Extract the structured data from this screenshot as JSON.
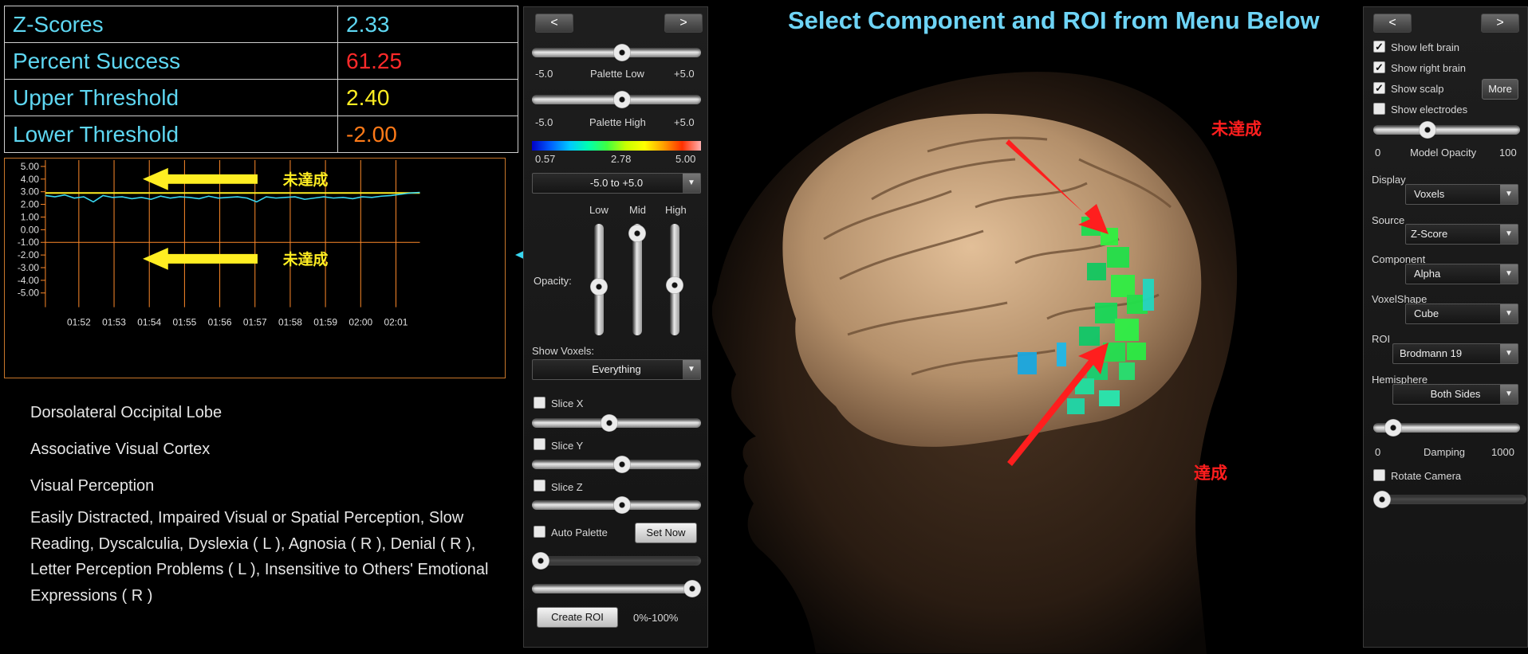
{
  "header": {
    "title": "Select Component and ROI from Menu Below"
  },
  "stats": [
    {
      "label": "Z-Scores",
      "value": "2.33",
      "color": "#5ed7f2"
    },
    {
      "label": "Percent Success",
      "value": "61.25",
      "color": "#ff2a2a"
    },
    {
      "label": "Upper Threshold",
      "value": "2.40",
      "color": "#ffee22"
    },
    {
      "label": "Lower Threshold",
      "value": "-2.00",
      "color": "#ff7a18"
    }
  ],
  "chart_data": {
    "type": "line",
    "x": [
      "01:52",
      "01:53",
      "01:54",
      "01:55",
      "01:56",
      "01:57",
      "01:58",
      "01:59",
      "02:00",
      "02:01"
    ],
    "ylim": [
      -5,
      5
    ],
    "yticks": [
      "5.00",
      "4.00",
      "3.00",
      "2.00",
      "1.00",
      "0.00",
      "-1.00",
      "-2.00",
      "-3.00",
      "-4.00",
      "-5.00"
    ],
    "upper_threshold": 2.9,
    "lower_threshold": -1.0,
    "series": [
      {
        "values": [
          2.7,
          2.6,
          2.75,
          2.5,
          2.6,
          2.2,
          2.7,
          2.55,
          2.6,
          2.45,
          2.55,
          2.4,
          2.65,
          2.5,
          2.6,
          2.55,
          2.45,
          2.65,
          2.5,
          2.55,
          2.6,
          2.5,
          2.2,
          2.6,
          2.5,
          2.55,
          2.6,
          2.4,
          2.5,
          2.6,
          2.5,
          2.55,
          2.45,
          2.6,
          2.55,
          2.65,
          2.7,
          2.8,
          2.9,
          2.95
        ]
      }
    ],
    "annotations": [
      {
        "text": "未達成",
        "color": "#ffee22"
      },
      {
        "text": "未達成",
        "color": "#ffee22"
      }
    ],
    "colors": {
      "grid": "#ff8a2a",
      "upper": "#ffee22",
      "series": "#38d6f0",
      "outside": "#38d6f0"
    },
    "outside_label": "達成"
  },
  "description": {
    "items": [
      "Dorsolateral Occipital Lobe",
      "Associative Visual Cortex",
      "Visual Perception"
    ],
    "symptoms": "Easily Distracted, Impaired Visual or Spatial Perception, Slow Reading, Dyscalculia, Dyslexia ( L ), Agnosia ( R ), Denial ( R ), Letter Perception Problems ( L ), Insensitive to Others' Emotional Expressions ( R )"
  },
  "panel_left": {
    "prev": "<",
    "next": ">",
    "palette_low": {
      "min": "-5.0",
      "label": "Palette Low",
      "max": "+5.0"
    },
    "palette_high": {
      "min": "-5.0",
      "label": "Palette High",
      "max": "+5.0"
    },
    "colorbar": {
      "min": "0.57",
      "mid": "2.78",
      "max": "5.00"
    },
    "range_select": "-5.0 to +5.0",
    "opacity": {
      "low": "Low",
      "mid": "Mid",
      "high": "High",
      "label": "Opacity:"
    },
    "show_voxels": {
      "label": "Show Voxels:",
      "value": "Everything"
    },
    "slice_x": "Slice X",
    "slice_y": "Slice Y",
    "slice_z": "Slice Z",
    "auto_palette": "Auto Palette",
    "set_now": "Set Now",
    "create_roi": "Create ROI",
    "roi_range": "0%-100%"
  },
  "panel_right": {
    "prev": "<",
    "next": ">",
    "show_left_brain": "Show left brain",
    "show_right_brain": "Show right brain",
    "show_scalp": "Show scalp",
    "more": "More",
    "show_electrodes": "Show electrodes",
    "model_opacity": {
      "min": "0",
      "label": "Model Opacity",
      "max": "100"
    },
    "display": {
      "label": "Display",
      "value": "Voxels"
    },
    "source": {
      "label": "Source",
      "value": "Z-Score"
    },
    "component": {
      "label": "Component",
      "value": "Alpha"
    },
    "voxel_shape": {
      "label": "VoxelShape",
      "value": "Cube"
    },
    "roi": {
      "label": "ROI",
      "value": "Brodmann 19"
    },
    "hemisphere": {
      "label": "Hemisphere",
      "value": "Both Sides"
    },
    "damping": {
      "min": "0",
      "label": "Damping",
      "max": "1000"
    },
    "rotate_camera": "Rotate Camera"
  },
  "brain_annotations": {
    "not_achieved": "未達成",
    "achieved": "達成",
    "color": "#ff1e1e"
  }
}
